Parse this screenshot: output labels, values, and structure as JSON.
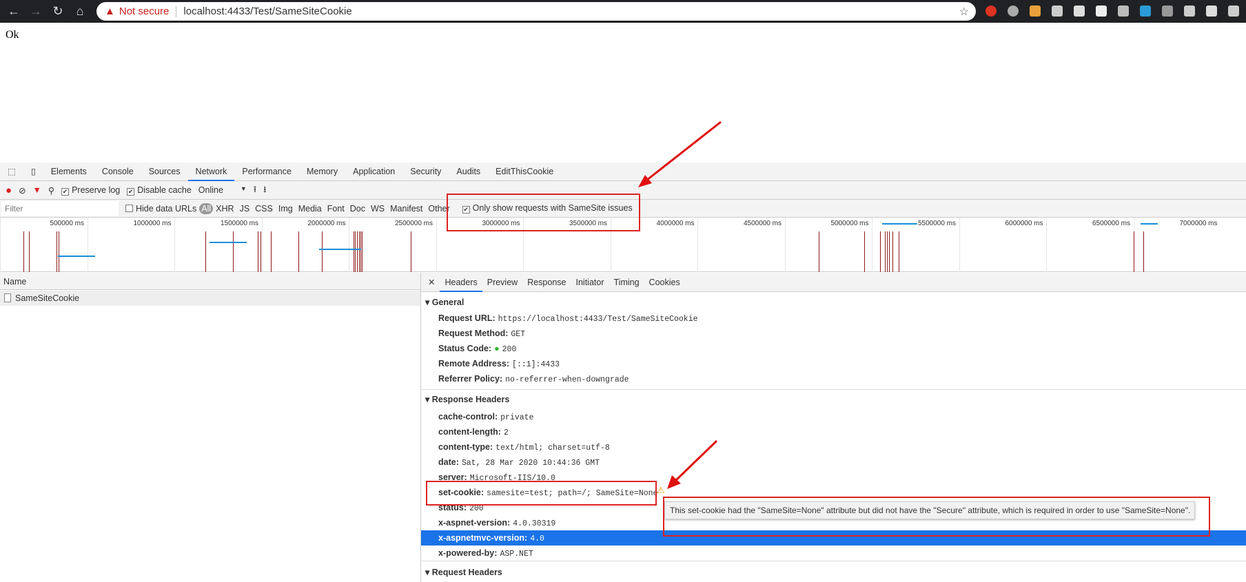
{
  "browser": {
    "not_secure": "Not secure",
    "url": "localhost:4433/Test/SameSiteCookie"
  },
  "page": {
    "body_text": "Ok"
  },
  "devtools": {
    "tabs": [
      "Elements",
      "Console",
      "Sources",
      "Network",
      "Performance",
      "Memory",
      "Application",
      "Security",
      "Audits",
      "EditThisCookie"
    ],
    "active_tab": "Network",
    "toolbar": {
      "preserve_log": "Preserve log",
      "disable_cache": "Disable cache",
      "throttle": "Online"
    },
    "filter": {
      "placeholder": "Filter",
      "hide_data_urls": "Hide data URLs",
      "types": [
        "All",
        "XHR",
        "JS",
        "CSS",
        "Img",
        "Media",
        "Font",
        "Doc",
        "WS",
        "Manifest",
        "Other"
      ],
      "samesite_only": "Only show requests with SameSite issues"
    },
    "overview_ticks": [
      "500000 ms",
      "1000000 ms",
      "1500000 ms",
      "2000000 ms",
      "2500000 ms",
      "3000000 ms",
      "3500000 ms",
      "4000000 ms",
      "4500000 ms",
      "5000000 ms",
      "5500000 ms",
      "6000000 ms",
      "6500000 ms",
      "7000000 ms"
    ],
    "requests": {
      "header": "Name",
      "items": [
        "SameSiteCookie"
      ]
    },
    "detail_tabs": [
      "Headers",
      "Preview",
      "Response",
      "Initiator",
      "Timing",
      "Cookies"
    ],
    "general": {
      "title": "General",
      "rows": [
        {
          "k": "Request URL:",
          "v": "https://localhost:4433/Test/SameSiteCookie"
        },
        {
          "k": "Request Method:",
          "v": "GET"
        },
        {
          "k": "Status Code:",
          "v": "200"
        },
        {
          "k": "Remote Address:",
          "v": "[::1]:4433"
        },
        {
          "k": "Referrer Policy:",
          "v": "no-referrer-when-downgrade"
        }
      ]
    },
    "response_headers": {
      "title": "Response Headers",
      "rows": [
        {
          "k": "cache-control:",
          "v": "private"
        },
        {
          "k": "content-length:",
          "v": "2"
        },
        {
          "k": "content-type:",
          "v": "text/html; charset=utf-8"
        },
        {
          "k": "date:",
          "v": "Sat, 28 Mar 2020 10:44:36 GMT"
        },
        {
          "k": "server:",
          "v": "Microsoft-IIS/10.0"
        },
        {
          "k": "set-cookie:",
          "v": "samesite=test; path=/; SameSite=None"
        },
        {
          "k": "status:",
          "v": "200"
        },
        {
          "k": "x-aspnet-version:",
          "v": "4.0.30319"
        },
        {
          "k": "x-aspnetmvc-version:",
          "v": "4.0"
        },
        {
          "k": "x-powered-by:",
          "v": "ASP.NET"
        }
      ]
    },
    "request_headers": {
      "title": "Request Headers"
    },
    "tooltip": "This set-cookie had the \"SameSite=None\" attribute but did not have the \"Secure\" attribute, which is required in order to use \"SameSite=None\"."
  }
}
